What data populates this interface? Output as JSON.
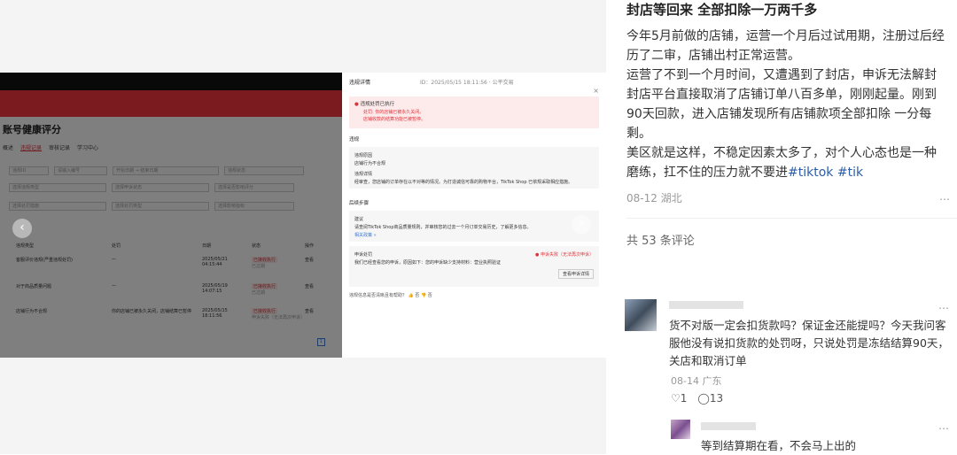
{
  "screenshot": {
    "page_title": "账号健康评分",
    "tabs": [
      "概述",
      "违规记录",
      "审核记录",
      "学习中心"
    ],
    "filters": [
      [
        "违规ID",
        "请输入编号",
        "开始日期 → 结束日期",
        "违规状态"
      ],
      [
        "选择违规类型",
        "选择申诉状态",
        "选择是否影响评分"
      ],
      [
        "选择处罚措施",
        "选择处罚类型",
        "选择影响指标"
      ]
    ],
    "table_headers": [
      "违规类型",
      "处罚",
      "日期",
      "状态",
      "操作"
    ],
    "rows": [
      {
        "type": "客服评价违规(严重违规处罚)",
        "penalty": "—",
        "date": "2025/05/21",
        "time": "04:15:44",
        "status": "已接收执行",
        "sub": "已过期",
        "action": "查看"
      },
      {
        "type": "对于商品质量问题",
        "penalty": "—",
        "date": "2025/05/19",
        "time": "14:07:15",
        "status": "已接收执行",
        "sub": "已过期",
        "action": "查看"
      },
      {
        "type": "店铺行为不合规",
        "penalty": "你的店铺已被永久关闭，店铺结算已暂停",
        "date": "2025/05/15",
        "time": "18:11:56",
        "status": "已接收执行",
        "sub": "申诉失败（无法再次申诉）",
        "action": "查看"
      }
    ],
    "page_number": "1",
    "drawer": {
      "title": "违规详情",
      "title_meta": "ID：2025/05/15 18:11:56 · 公平交易",
      "close": "×",
      "alert_title": "违规处罚已执行",
      "alert_lines": [
        "处罚: 你的店铺已被永久关闭。",
        "店铺收款的结算功能已被暂停。"
      ],
      "section_violation": "违规",
      "violation_reason_label": "违规原因",
      "violation_reason": "店铺行为不合规",
      "violation_detail_label": "违规详情",
      "violation_detail": "经审查，您店铺的订单存在以不对等的情况。为打造诚信可靠的购物平台，TikTok Shop 已依规采取相应措施。",
      "section_next": "后续步骤",
      "advice_label": "建议",
      "advice": "请查阅TikTok Shop商品质量规则，并审核您的过去一个月订单交易历史，了解更多信息。",
      "advice_link": "相关政策 »",
      "appeal_label": "申诉处罚",
      "appeal_status": "● 申诉失败（无法再次申诉）",
      "appeal_text": "我们已经查看您的申诉，原因如下：您的申诉缺少支持材料：营业执照验证",
      "appeal_button": "查看申诉详情",
      "feedback": "违规信息是否清晰且有帮助？  👍 否  👎 否"
    }
  },
  "post": {
    "title": "封店等回来 全部扣除一万两千多",
    "paragraphs": [
      "今年5月前做的店铺，运营一个月后过试用期，注册过后经历了二审，店铺出村正常运营。",
      "运营了不到一个月时间，又遭遇到了封店，申诉无法解封",
      "封店平台直接取消了店铺订单八百多单，刚刚起量。刚到90天回款，进入店铺发现所有店铺款项全部扣除 一分每剩。",
      "美区就是这样，不稳定因素太多了，对个人心态也是一种磨练，扛不住的压力就不要进"
    ],
    "hashtags": [
      "#tiktok",
      "#tik"
    ],
    "date_location": "08-12 湖北",
    "more": "…"
  },
  "comments": {
    "count_label": "共 53 条评论",
    "items": [
      {
        "text": "货不对版一定会扣货款吗？保证金还能提吗？今天我问客服他没有说扣货款的处罚呀，只说处罚是冻结结算90天，关店和取消订单",
        "meta": "08-14 广东",
        "likes": "♡1",
        "replies": "◯13",
        "more": "…"
      },
      {
        "text": "等到结算期在看，不会马上出的",
        "more": "…"
      }
    ]
  }
}
